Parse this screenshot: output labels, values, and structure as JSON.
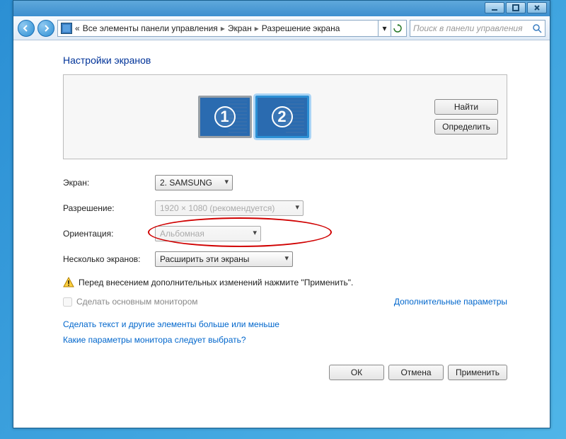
{
  "breadcrumb": {
    "prefix": "«",
    "items": [
      "Все элементы панели управления",
      "Экран",
      "Разрешение экрана"
    ]
  },
  "search": {
    "placeholder": "Поиск в панели управления"
  },
  "heading": "Настройки экранов",
  "monitors": [
    "1",
    "2"
  ],
  "side": {
    "find": "Найти",
    "identify": "Определить"
  },
  "fields": {
    "screen_label": "Экран:",
    "screen_value": "2. SAMSUNG",
    "res_label": "Разрешение:",
    "res_value": "1920 × 1080 (рекомендуется)",
    "orient_label": "Ориентация:",
    "orient_value": "Альбомная",
    "multi_label": "Несколько экранов:",
    "multi_value": "Расширить эти экраны"
  },
  "warning": "Перед внесением дополнительных изменений нажмите \"Применить\".",
  "checkbox": "Сделать основным монитором",
  "extra_link": "Дополнительные параметры",
  "link1": "Сделать текст и другие элементы больше или меньше",
  "link2": "Какие параметры монитора следует выбрать?",
  "buttons": {
    "ok": "ОК",
    "cancel": "Отмена",
    "apply": "Применить"
  }
}
